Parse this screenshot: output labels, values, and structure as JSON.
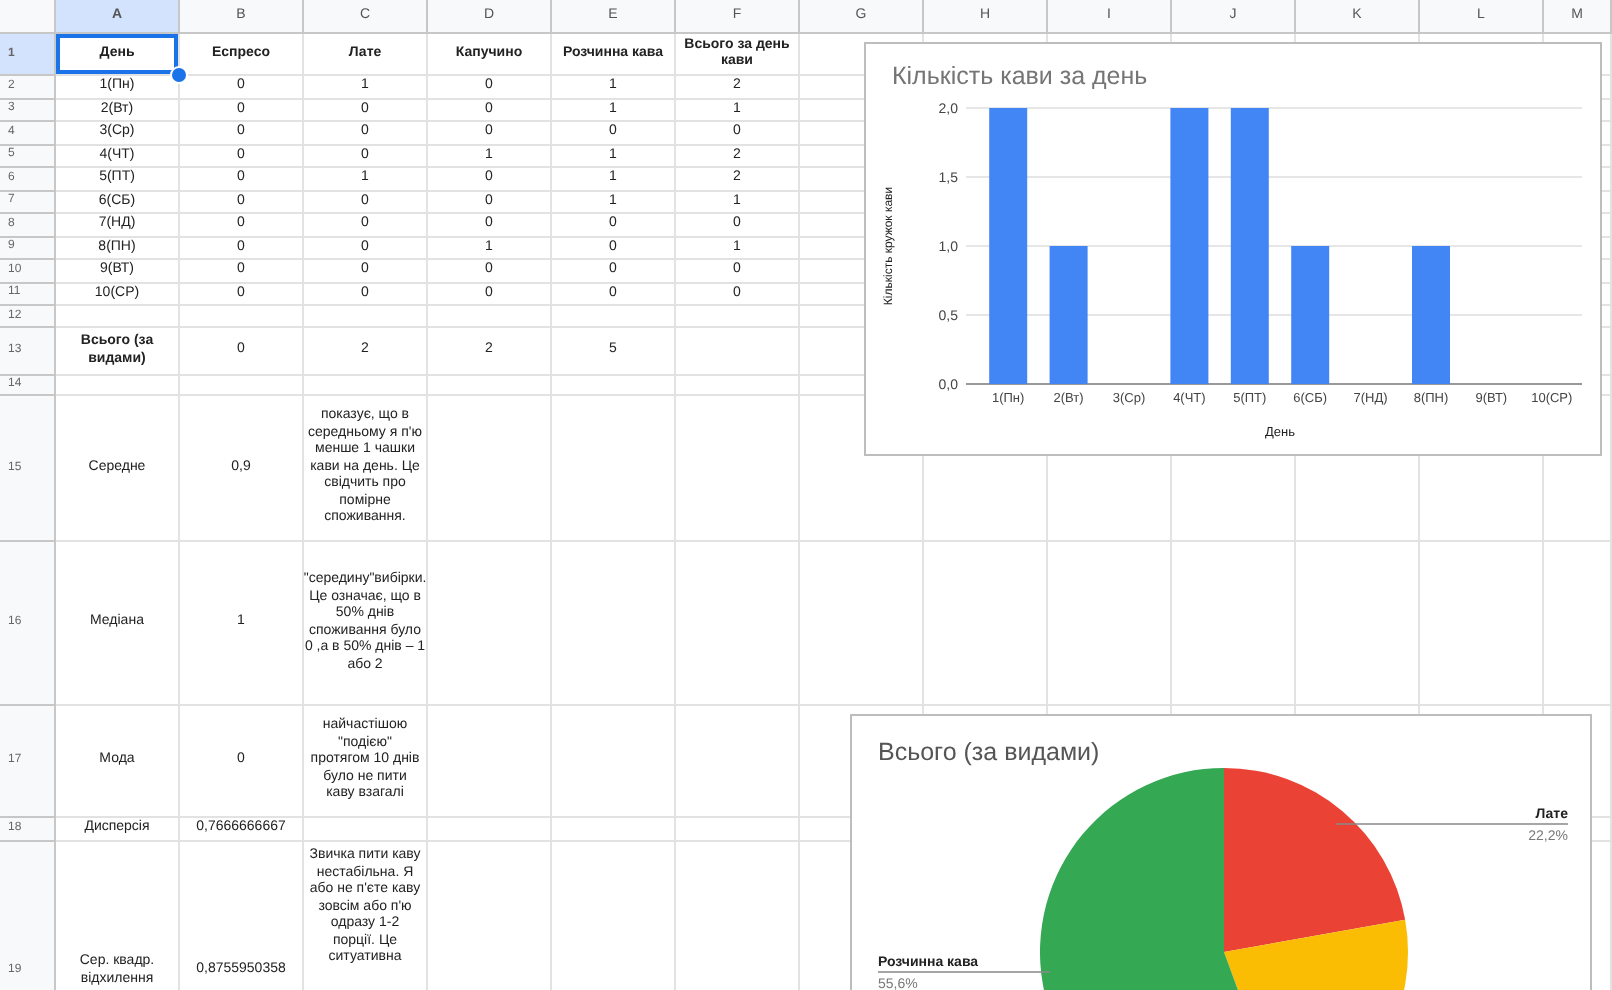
{
  "columns": [
    "A",
    "B",
    "C",
    "D",
    "E",
    "F",
    "G",
    "H",
    "I",
    "J",
    "K",
    "L",
    "M"
  ],
  "rows": [
    {
      "number": "1",
      "cells": [
        {
          "text": "День",
          "selected": true
        },
        {
          "text": "Еспресо",
          "selected": false
        },
        {
          "text": "Лате",
          "selected": false
        },
        {
          "text": "Капучино",
          "selected": false
        },
        {
          "text": "Розчинна кава",
          "selected": false
        },
        {
          "text": "Всього за день кави",
          "selected": false
        }
      ]
    },
    {
      "number": "2",
      "cells": [
        "1(Пн)",
        "0",
        "1",
        "0",
        "1",
        "2"
      ]
    },
    {
      "number": "3",
      "cells": [
        "2(Вт)",
        "0",
        "0",
        "0",
        "1",
        "1"
      ]
    },
    {
      "number": "4",
      "cells": [
        "3(Ср)",
        "0",
        "0",
        "0",
        "0",
        "0"
      ]
    },
    {
      "number": "5",
      "cells": [
        "4(ЧТ)",
        "0",
        "0",
        "1",
        "1",
        "2"
      ]
    },
    {
      "number": "6",
      "cells": [
        "5(ПТ)",
        "0",
        "1",
        "0",
        "1",
        "2"
      ]
    },
    {
      "number": "7",
      "cells": [
        "6(СБ)",
        "0",
        "0",
        "0",
        "1",
        "1"
      ]
    },
    {
      "number": "8",
      "cells": [
        "7(НД)",
        "0",
        "0",
        "0",
        "0",
        "0"
      ]
    },
    {
      "number": "9",
      "cells": [
        "8(ПН)",
        "0",
        "0",
        "1",
        "0",
        "1"
      ]
    },
    {
      "number": "10",
      "cells": [
        "9(ВТ)",
        "0",
        "0",
        "0",
        "0",
        "0"
      ]
    },
    {
      "number": "11",
      "cells": [
        "10(СР)",
        "0",
        "0",
        "0",
        "0",
        "0"
      ]
    },
    {
      "number": "12",
      "cells": []
    },
    {
      "number": "13",
      "cells": [
        "Всього (за видами)",
        "0",
        "2",
        "2",
        "5"
      ]
    },
    {
      "number": "14",
      "cells": []
    },
    {
      "number": "15",
      "cells": [
        "Середне",
        "0,9",
        "показує, що в середньому я п'ю менше 1 чашки кави на день. Це свідчить про помірне споживання."
      ]
    },
    {
      "number": "16",
      "cells": [
        "Медіана",
        "1",
        "\"середину\"вибірки. Це означає, що в 50% днів споживання було 0 ,а в 50% днів – 1 або 2"
      ]
    },
    {
      "number": "17",
      "cells": [
        "Мода",
        "0",
        "найчастішою \"подією\" протягом 10 днів було не пити каву взагалі"
      ]
    },
    {
      "number": "18",
      "cells": [
        "Дисперсія",
        "0,7666666667"
      ]
    },
    {
      "number": "19",
      "cells": [
        "Сер. квадр. відхилення",
        "0,8755950358",
        "Звичка пити каву нестабільна. Я або не п'єте каву зовсім або п'ю одразу 1-2 порції. Це ситуативна"
      ]
    }
  ],
  "charts": [
    {
      "chart_data": {
        "type": "bar",
        "title": "Кількість кави  за день",
        "xlabel": "День",
        "ylabel": "Кількість кружок кави",
        "categories": [
          "1(Пн)",
          "2(Вт)",
          "3(Ср)",
          "4(ЧТ)",
          "5(ПТ)",
          "6(СБ)",
          "7(НД)",
          "8(ПН)",
          "9(ВТ)",
          "10(СР)"
        ],
        "values": [
          2,
          1,
          0,
          2,
          2,
          1,
          0,
          1,
          0,
          0
        ],
        "grid": true,
        "ylim": [
          0,
          2
        ],
        "yticks": [
          {
            "value": 0,
            "label": "0,0"
          },
          {
            "value": 0.5,
            "label": "0,5"
          },
          {
            "value": 1,
            "label": "1,0"
          },
          {
            "value": 1.5,
            "label": "1,5"
          },
          {
            "value": 2,
            "label": "2,0"
          }
        ]
      }
    },
    {
      "chart_data": {
        "type": "pie",
        "title": "Всього (за видами)",
        "values": [
          22.2,
          22.2,
          55.6
        ]
      },
      "slice_labels": [
        {
          "name": "Лате",
          "percent": "22,2%"
        },
        {
          "name": "Розчинна кава",
          "percent": "55,6%"
        }
      ]
    }
  ]
}
